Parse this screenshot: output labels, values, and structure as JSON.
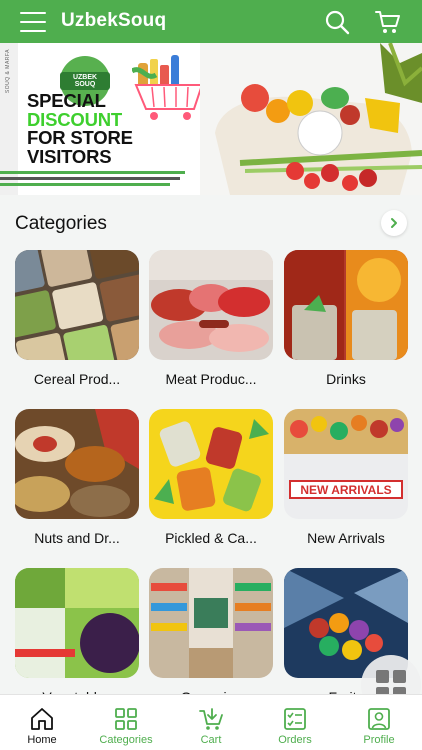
{
  "header": {
    "title": "UzbekSouq",
    "menu_icon": "hamburger-menu-icon",
    "search_icon": "search-icon",
    "cart_icon": "cart-icon",
    "bg_color": "#4fae4e"
  },
  "banner": {
    "logo_text": "UZBEK SOUQ",
    "side_text": "SOUQ & MARFA",
    "promo_line1": "SPECIAL",
    "promo_line2": "DISCOUNT",
    "promo_line3": "FOR STORE",
    "promo_line4": "VISITORS",
    "accent_color": "#3ecf2e"
  },
  "categories": {
    "title": "Categories",
    "more_icon": "chevron-right-icon",
    "items": [
      {
        "label": "Cereal Prod..."
      },
      {
        "label": "Meat Produc..."
      },
      {
        "label": "Drinks"
      },
      {
        "label": "Nuts and Dr..."
      },
      {
        "label": "Pickled & Ca..."
      },
      {
        "label": "New Arrivals"
      },
      {
        "label": "Vegetables"
      },
      {
        "label": "Groceries"
      },
      {
        "label": "Fruits"
      }
    ],
    "new_arrivals_sign": "NEW ARRIVALS"
  },
  "fab": {
    "icon": "grid-icon"
  },
  "bottom_nav": {
    "active": "Home",
    "items": [
      {
        "label": "Home",
        "icon": "home-icon"
      },
      {
        "label": "Categories",
        "icon": "categories-grid-icon"
      },
      {
        "label": "Cart",
        "icon": "cart-icon"
      },
      {
        "label": "Orders",
        "icon": "orders-checklist-icon"
      },
      {
        "label": "Profile",
        "icon": "profile-icon"
      }
    ]
  }
}
